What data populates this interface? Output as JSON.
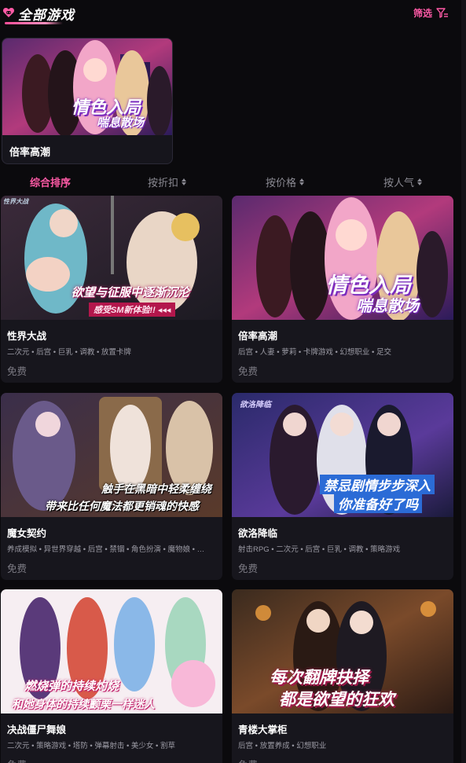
{
  "header": {
    "title": "全部游戏",
    "filter_label": "筛选",
    "logo_icon": "heart-gamepad-icon",
    "filter_icon": "filter-funnel-icon"
  },
  "featured": {
    "name": "倍率高潮",
    "banner_line1": "情色入局",
    "banner_line2": "喘息散场"
  },
  "sort_tabs": [
    {
      "label": "综合排序",
      "active": true
    },
    {
      "label": "按折扣",
      "active": false
    },
    {
      "label": "按价格",
      "active": false
    },
    {
      "label": "按人气",
      "active": false
    }
  ],
  "games": [
    {
      "name": "性界大战",
      "tags": "二次元 • 后宫 • 巨乳 • 调教 • 放置卡牌",
      "price": "免费",
      "banner": "欲望与征服中逐渐沉沦",
      "subbanner": "感受SM新体验!! ◂◂◂",
      "corner": "性界大战"
    },
    {
      "name": "倍率高潮",
      "tags": "后宫 • 人妻 • 萝莉 • 卡牌游戏 • 幻想职业 • 足交",
      "price": "免费",
      "banner": "情色入局",
      "subbanner": "喘息散场",
      "corner": ""
    },
    {
      "name": "魔女契约",
      "tags": "养成模拟 • 异世界穿越 • 后宫 • 禁锢 • 角色扮演 • 魔物娘 • …",
      "price": "免费",
      "banner": "触手在黑暗中轻柔缠绕",
      "subbanner": "带来比任何魔法都更销魂的快感",
      "corner": ""
    },
    {
      "name": "欲洛降临",
      "tags": "射击RPG • 二次元 • 后宫 • 巨乳 • 调教 • 策略游戏",
      "price": "免费",
      "banner": "禁忌剧情步步深入",
      "subbanner": "你准备好了吗",
      "corner": "欲洛降临"
    },
    {
      "name": "决战僵尸舞娘",
      "tags": "二次元 • 策略游戏 • 塔防 • 弹幕射击 • 美少女 • 割草",
      "price": "免费",
      "banner": "燃烧弹的持续灼烧",
      "subbanner": "和她身体的持续颤栗一样迷人",
      "corner": ""
    },
    {
      "name": "青楼大掌柜",
      "tags": "后宫 • 放置养成 • 幻想职业",
      "price": "免费",
      "banner": "每次翻牌抉择",
      "subbanner": "都是欲望的狂欢",
      "corner": ""
    }
  ],
  "colors": {
    "accent": "#ff5aa6",
    "background": "#0b0a0d",
    "card": "#17161d",
    "muted": "#9b9aa4"
  }
}
